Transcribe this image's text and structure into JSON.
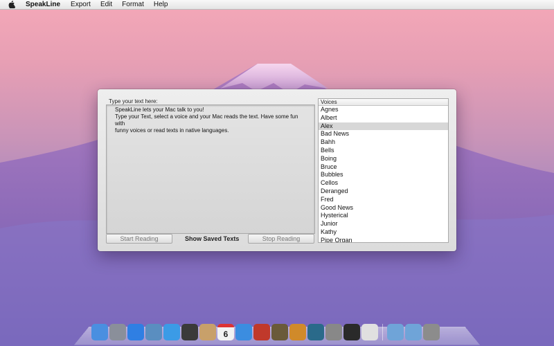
{
  "menubar": {
    "app_name": "SpeakLine",
    "items": [
      "Export",
      "Edit",
      "Format",
      "Help"
    ]
  },
  "window": {
    "text_label": "Type your text here:",
    "text_lines": [
      "SpeakLine lets your Mac talk to you!",
      "Type your Text, select a voice and your Mac reads the text. Have some fun with",
      "funny voices or read texts in native languages."
    ],
    "start_button": "Start Reading",
    "saved_label": "Show Saved Texts",
    "stop_button": "Stop Reading",
    "voices_header": "Voices",
    "selected_voice": "Alex",
    "voices": [
      "Agnes",
      "Albert",
      "Alex",
      "Bad News",
      "Bahh",
      "Bells",
      "Boing",
      "Bruce",
      "Bubbles",
      "Cellos",
      "Deranged",
      "Fred",
      "Good News",
      "Hysterical",
      "Junior",
      "Kathy",
      "Pipe Organ"
    ]
  },
  "dock": {
    "calendar_day": "6",
    "apps": [
      {
        "name": "finder-icon",
        "color": "#4a8fe0"
      },
      {
        "name": "launchpad-icon",
        "color": "#8a8f9a"
      },
      {
        "name": "app-store-icon",
        "color": "#2f7fe3"
      },
      {
        "name": "mail-stamp-icon",
        "color": "#5a8ec0"
      },
      {
        "name": "safari-icon",
        "color": "#3b9be6"
      },
      {
        "name": "facetime-icon",
        "color": "#3a3a3a"
      },
      {
        "name": "address-book-icon",
        "color": "#c8a06a"
      },
      {
        "name": "calendar-icon",
        "color": "#f2f2f2"
      },
      {
        "name": "itunes-icon",
        "color": "#3b8de0"
      },
      {
        "name": "photo-booth-icon",
        "color": "#c0392b"
      },
      {
        "name": "imovie-icon",
        "color": "#6a5a3a"
      },
      {
        "name": "garageband-icon",
        "color": "#d08a2a"
      },
      {
        "name": "time-machine-icon",
        "color": "#2a6a8a"
      },
      {
        "name": "system-preferences-icon",
        "color": "#888888"
      },
      {
        "name": "activity-monitor-icon",
        "color": "#2a2a2a"
      },
      {
        "name": "textedit-icon",
        "color": "#e0e0e0"
      }
    ],
    "right_items": [
      {
        "name": "applications-folder-icon",
        "color": "#6fa4d8"
      },
      {
        "name": "downloads-folder-icon",
        "color": "#6fa4d8"
      },
      {
        "name": "trash-icon",
        "color": "#8c8c8c"
      }
    ]
  }
}
